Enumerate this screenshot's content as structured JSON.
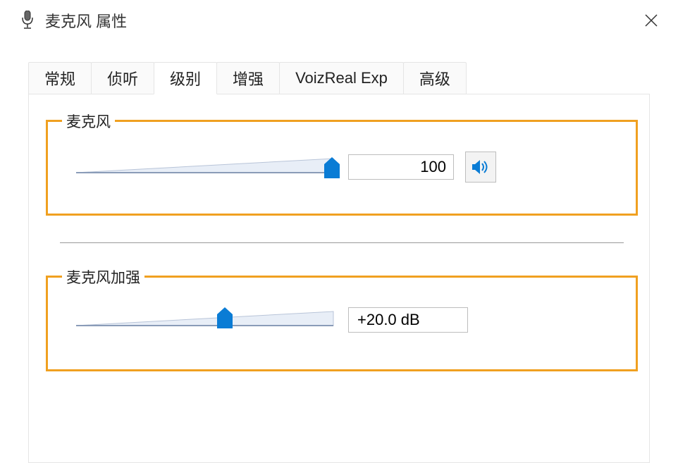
{
  "window": {
    "title": "麦克风 属性"
  },
  "tabs": {
    "items": [
      {
        "label": "常规"
      },
      {
        "label": "侦听"
      },
      {
        "label": "级别"
      },
      {
        "label": "增强"
      },
      {
        "label": "VoizReal Exp"
      },
      {
        "label": "高级"
      }
    ],
    "active_index": 2
  },
  "microphone_group": {
    "label": "麦克风",
    "value": "100",
    "slider_percent": 100
  },
  "boost_group": {
    "label": "麦克风加强",
    "value": "+20.0 dB",
    "slider_percent": 56
  }
}
